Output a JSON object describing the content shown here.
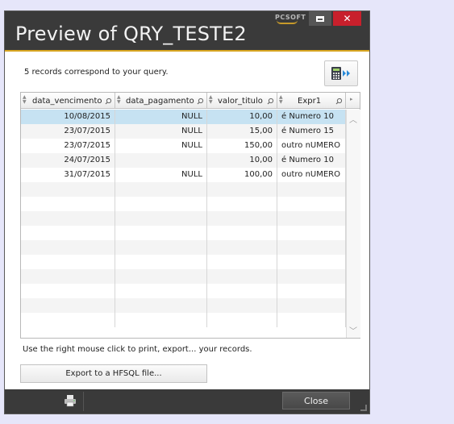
{
  "window": {
    "title": "Preview of QRY_TESTE2",
    "logo_text": "PCSOFT",
    "close_symbol": "✕",
    "accent_color": "#d8a520"
  },
  "main": {
    "records_message": "5 records correspond to your query.",
    "calculator_button_icon": "calculator-forward-icon",
    "hint": "Use the right mouse click to print, export... your records.",
    "export_label": "Export to a HFSQL file..."
  },
  "table": {
    "columns": [
      "data_vencimento",
      "data_pagamento",
      "valor_titulo",
      "Expr1"
    ],
    "rows": [
      {
        "data_vencimento": "10/08/2015",
        "data_pagamento": "NULL",
        "valor_titulo": "10,00",
        "Expr1": "é Numero 10",
        "selected": true
      },
      {
        "data_vencimento": "23/07/2015",
        "data_pagamento": "NULL",
        "valor_titulo": "15,00",
        "Expr1": "é Numero 15",
        "selected": false
      },
      {
        "data_vencimento": "23/07/2015",
        "data_pagamento": "NULL",
        "valor_titulo": "150,00",
        "Expr1": "outro nUMERO",
        "selected": false
      },
      {
        "data_vencimento": "24/07/2015",
        "data_pagamento": "",
        "valor_titulo": "10,00",
        "Expr1": "é Numero 10",
        "selected": false
      },
      {
        "data_vencimento": "31/07/2015",
        "data_pagamento": "NULL",
        "valor_titulo": "100,00",
        "Expr1": "outro nUMERO",
        "selected": false
      }
    ],
    "selected_color": "#c6e2f2"
  },
  "footer": {
    "print_icon": "printer-icon",
    "close_label": "Close"
  }
}
